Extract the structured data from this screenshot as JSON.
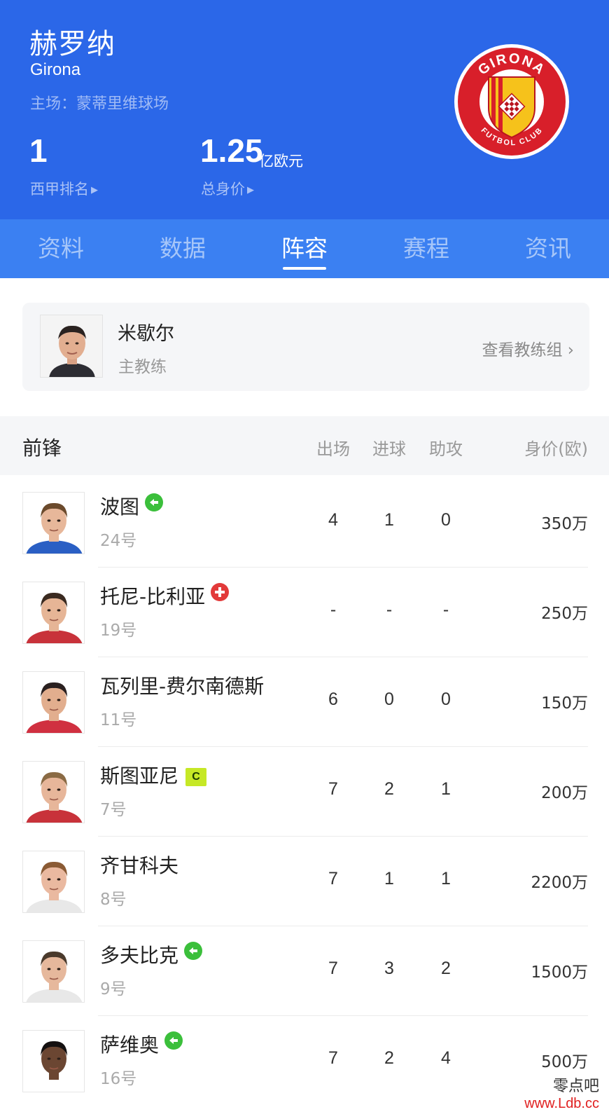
{
  "team": {
    "name_cn": "赫罗纳",
    "name_en": "Girona",
    "stadium": "主场：蒙蒂里维球场",
    "rank_value": "1",
    "rank_label": "西甲排名",
    "value_number": "1.25",
    "value_unit": "亿欧元",
    "value_label": "总身价",
    "logo_text_top": "GIRONA",
    "logo_text_bottom": "FUTBOL CLUB"
  },
  "tabs": [
    "资料",
    "数据",
    "阵容",
    "赛程",
    "资讯"
  ],
  "active_tab": 2,
  "coach": {
    "name": "米歇尔",
    "role": "主教练",
    "link": "查看教练组 ›"
  },
  "section": {
    "title": "前锋",
    "columns": [
      "出场",
      "进球",
      "助攻",
      "身价(欧)"
    ]
  },
  "players": [
    {
      "name": "波图",
      "number": "24号",
      "apps": "4",
      "goals": "1",
      "assists": "0",
      "value": "350万",
      "badge": "injury-return"
    },
    {
      "name": "托尼-比利亚",
      "number": "19号",
      "apps": "-",
      "goals": "-",
      "assists": "-",
      "value": "250万",
      "badge": "injury"
    },
    {
      "name": "瓦列里-费尔南德斯",
      "number": "11号",
      "apps": "6",
      "goals": "0",
      "assists": "0",
      "value": "150万",
      "badge": ""
    },
    {
      "name": "斯图亚尼",
      "number": "7号",
      "apps": "7",
      "goals": "2",
      "assists": "1",
      "value": "200万",
      "badge": "captain",
      "badge_text": "C"
    },
    {
      "name": "齐甘科夫",
      "number": "8号",
      "apps": "7",
      "goals": "1",
      "assists": "1",
      "value": "2200万",
      "badge": ""
    },
    {
      "name": "多夫比克",
      "number": "9号",
      "apps": "7",
      "goals": "3",
      "assists": "2",
      "value": "1500万",
      "badge": "injury-return"
    },
    {
      "name": "萨维奥",
      "number": "16号",
      "apps": "7",
      "goals": "2",
      "assists": "4",
      "value": "500万",
      "badge": "injury-return"
    }
  ],
  "watermark": {
    "line1": "零点吧",
    "line2": "www.Ldb.cc"
  },
  "colors": {
    "header": "#2b67e8",
    "tabs": "#3b80f2",
    "return_badge": "#3bbf3b",
    "injury_badge": "#e23a3a",
    "captain_badge": "#c6e826"
  }
}
